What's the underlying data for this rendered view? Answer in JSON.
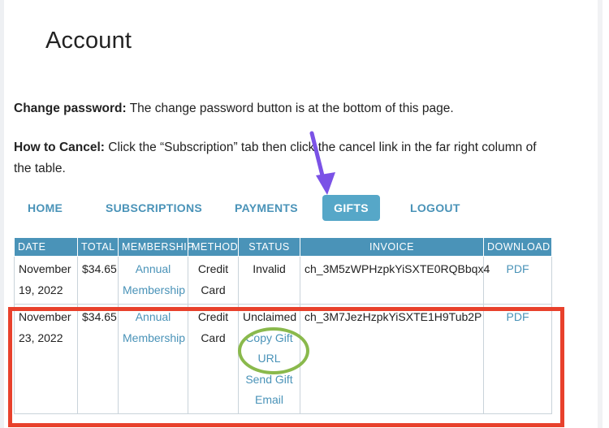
{
  "page": {
    "title": "Account"
  },
  "info": {
    "change_password_label": "Change password:",
    "change_password_text": " The change password button is at the bottom of this page.",
    "how_to_cancel_label": "How to Cancel:",
    "how_to_cancel_text": " Click the “Subscription” tab then click the cancel link in the far right column of the table."
  },
  "nav": {
    "items": [
      {
        "label": "HOME"
      },
      {
        "label": "SUBSCRIPTIONS"
      },
      {
        "label": "PAYMENTS"
      },
      {
        "label": "GIFTS",
        "active": true
      },
      {
        "label": "LOGOUT"
      }
    ]
  },
  "table": {
    "headers": [
      "DATE",
      "TOTAL",
      "MEMBERSHIP",
      "METHOD",
      "STATUS",
      "INVOICE",
      "DOWNLOAD"
    ],
    "rows": [
      {
        "date": "November 19, 2022",
        "total": "$34.65",
        "membership": "Annual Membership",
        "method": "Credit Card",
        "status": "Invalid",
        "invoice": "ch_3M5zWPHzpkYiSXTE0RQBbqx4",
        "download": "PDF"
      },
      {
        "date": "November 23, 2022",
        "total": "$34.65",
        "membership": "Annual Membership",
        "method": "Credit Card",
        "status": "Unclaimed",
        "copy_gift_url": "Copy Gift URL",
        "send_gift_email": "Send Gift Email",
        "invoice": "ch_3M7JezHzpkYiSXTE1H9Tub2P",
        "download": "PDF"
      }
    ]
  },
  "annotations": {
    "arrow_color": "#7b52e6",
    "box_color": "#e8412c",
    "oval_color": "#8ab94c"
  },
  "colors": {
    "accent": "#4a93b8",
    "active_tab": "#56a7c8"
  }
}
